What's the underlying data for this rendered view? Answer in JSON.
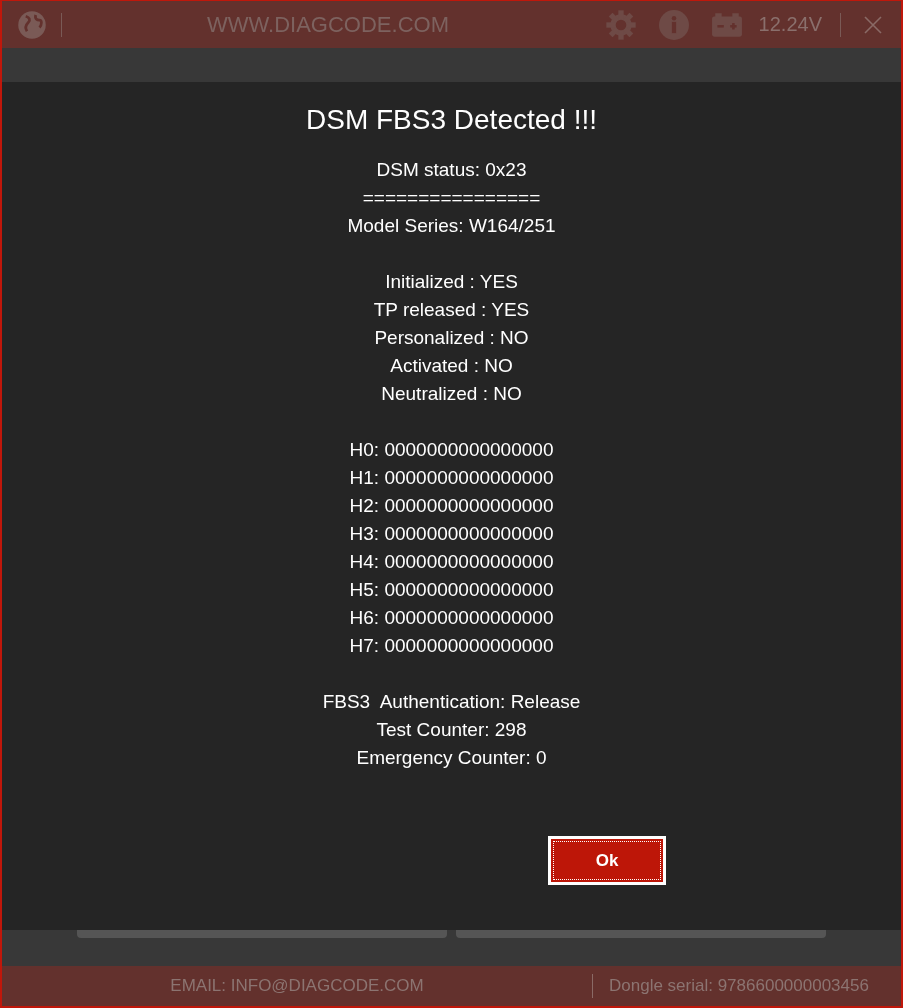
{
  "header": {
    "title": "WWW.DIAGCODE.COM",
    "voltage": "12.24V"
  },
  "dialog": {
    "title": "DSM FBS3 Detected !!!",
    "groups": [
      [
        "DSM status: 0x23",
        "================",
        "Model Series: W164/251"
      ],
      [
        "Initialized : YES",
        "TP released : YES",
        "Personalized : NO",
        "Activated : NO",
        "Neutralized : NO"
      ],
      [
        "H0: 0000000000000000",
        "H1: 0000000000000000",
        "H2: 0000000000000000",
        "H3: 0000000000000000",
        "H4: 0000000000000000",
        "H5: 0000000000000000",
        "H6: 0000000000000000",
        "H7: 0000000000000000"
      ],
      [
        "FBS3  Authentication: Release",
        "Test Counter: 298",
        "Emergency Counter: 0"
      ]
    ],
    "button": "Ok"
  },
  "footer": {
    "email": "EMAIL: INFO@DIAGCODE.COM",
    "serial": "Dongle serial: 9786600000003456"
  }
}
